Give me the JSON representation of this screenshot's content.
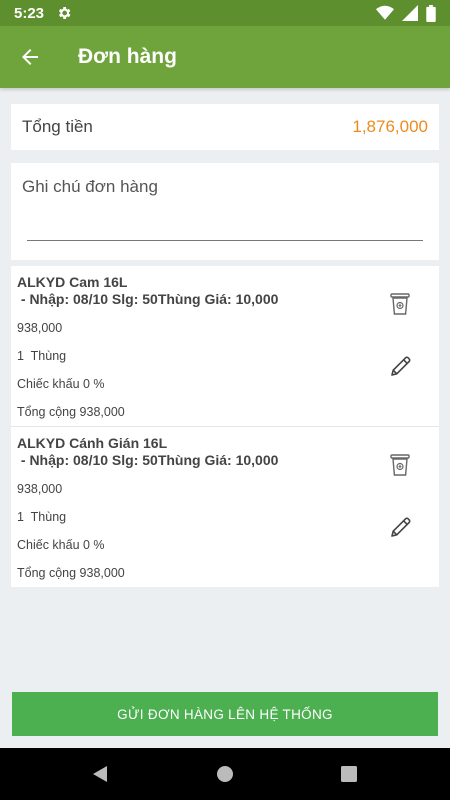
{
  "status_bar": {
    "time": "5:23",
    "icons": [
      "gear-icon",
      "wifi-icon",
      "signal-icon",
      "battery-icon"
    ]
  },
  "app_bar": {
    "title": "Đơn hàng",
    "back_icon": "arrow-left-icon"
  },
  "summary": {
    "total_label": "Tổng tiền",
    "total_value": "1,876,000",
    "total_color": "#ee8b1f"
  },
  "note": {
    "placeholder": "Ghi chú đơn hàng",
    "value": ""
  },
  "items": [
    {
      "name": "ALKYD Cam 16L",
      "detail": " - Nhập: 08/10 Slg: 50Thùng Giá: 10,000",
      "price": "938,000",
      "quantity": "1  Thùng",
      "discount": "Chiếc khấu 0 %",
      "subtotal": "Tổng cộng 938,000"
    },
    {
      "name": "ALKYD Cánh Gián 16L",
      "detail": " - Nhập: 08/10 Slg: 50Thùng Giá: 10,000",
      "price": "938,000",
      "quantity": "1  Thùng",
      "discount": "Chiếc khấu 0 %",
      "subtotal": "Tổng cộng 938,000"
    }
  ],
  "actions": {
    "submit_label": "GỬI ĐƠN HÀNG LÊN HỆ THỐNG"
  },
  "colors": {
    "status_bar": "#5d8f2f",
    "app_bar": "#6ea43b",
    "submit_button": "#4caf50",
    "background": "#eceff1"
  }
}
